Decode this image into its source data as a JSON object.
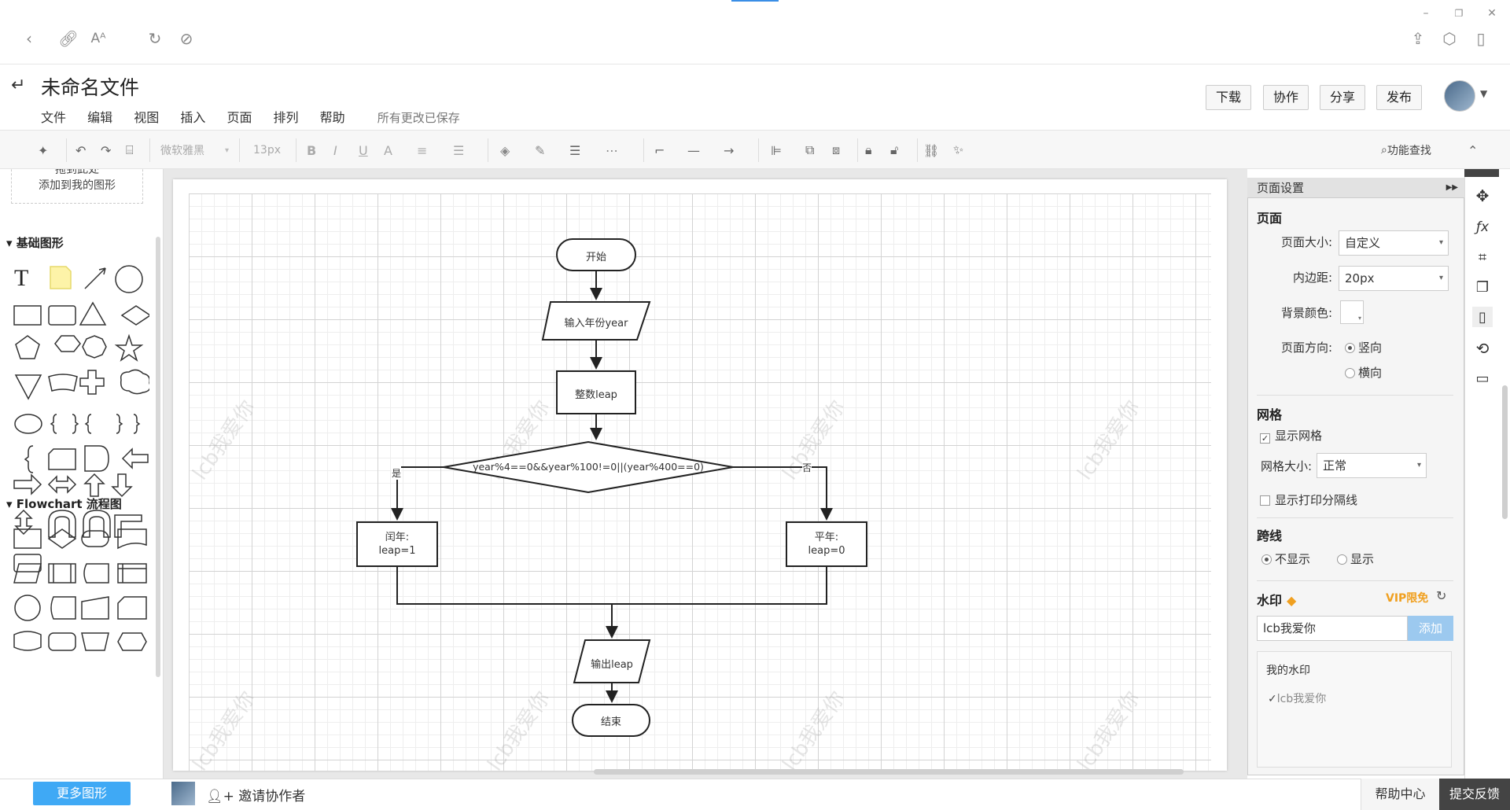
{
  "header": {
    "title": "未命名文件",
    "save_status": "所有更改已保存",
    "menu": [
      "文件",
      "编辑",
      "视图",
      "插入",
      "页面",
      "排列",
      "帮助"
    ],
    "buttons": {
      "download": "下载",
      "collab": "协作",
      "share": "分享",
      "publish": "发布"
    }
  },
  "toolbar": {
    "font_family": "微软雅黑",
    "font_size": "13px",
    "feature_search": "功能查找"
  },
  "left": {
    "drop_line1": "拖到此处",
    "drop_line2": "添加到我的图形",
    "group_basic": "基础图形",
    "group_flow": "Flowchart 流程图",
    "more_shapes": "更多图形"
  },
  "flow": {
    "start": "开始",
    "input": "输入年份year",
    "int": "整数leap",
    "cond": "year%4==0&&year%100!=0||(year%400==0)",
    "yes": "是",
    "no": "否",
    "leap1": "闰年:",
    "leap1b": "leap=1",
    "leap0": "平年:",
    "leap0b": "leap=0",
    "output": "输出leap",
    "end": "结束"
  },
  "watermark": "lcb我爱你",
  "panel": {
    "title": "页面设置",
    "sec_page": "页面",
    "size_label": "页面大小:",
    "size_value": "自定义",
    "padding_label": "内边距:",
    "padding_value": "20px",
    "bg_label": "背景颜色:",
    "orient_label": "页面方向:",
    "portrait": "竖向",
    "landscape": "横向",
    "sec_grid": "网格",
    "show_grid": "显示网格",
    "grid_size_label": "网格大小:",
    "grid_size_value": "正常",
    "show_print": "显示打印分隔线",
    "sec_jump": "跨线",
    "jump_hide": "不显示",
    "jump_show": "显示",
    "sec_wm": "水印",
    "vip": "VIP限免",
    "wm_input": "lcb我爱你",
    "wm_add": "添加",
    "my_wm": "我的水印",
    "my_wm_item": "lcb我爱你"
  },
  "bottom": {
    "invite": "邀请协作者",
    "help": "帮助中心",
    "feedback": "提交反馈"
  }
}
